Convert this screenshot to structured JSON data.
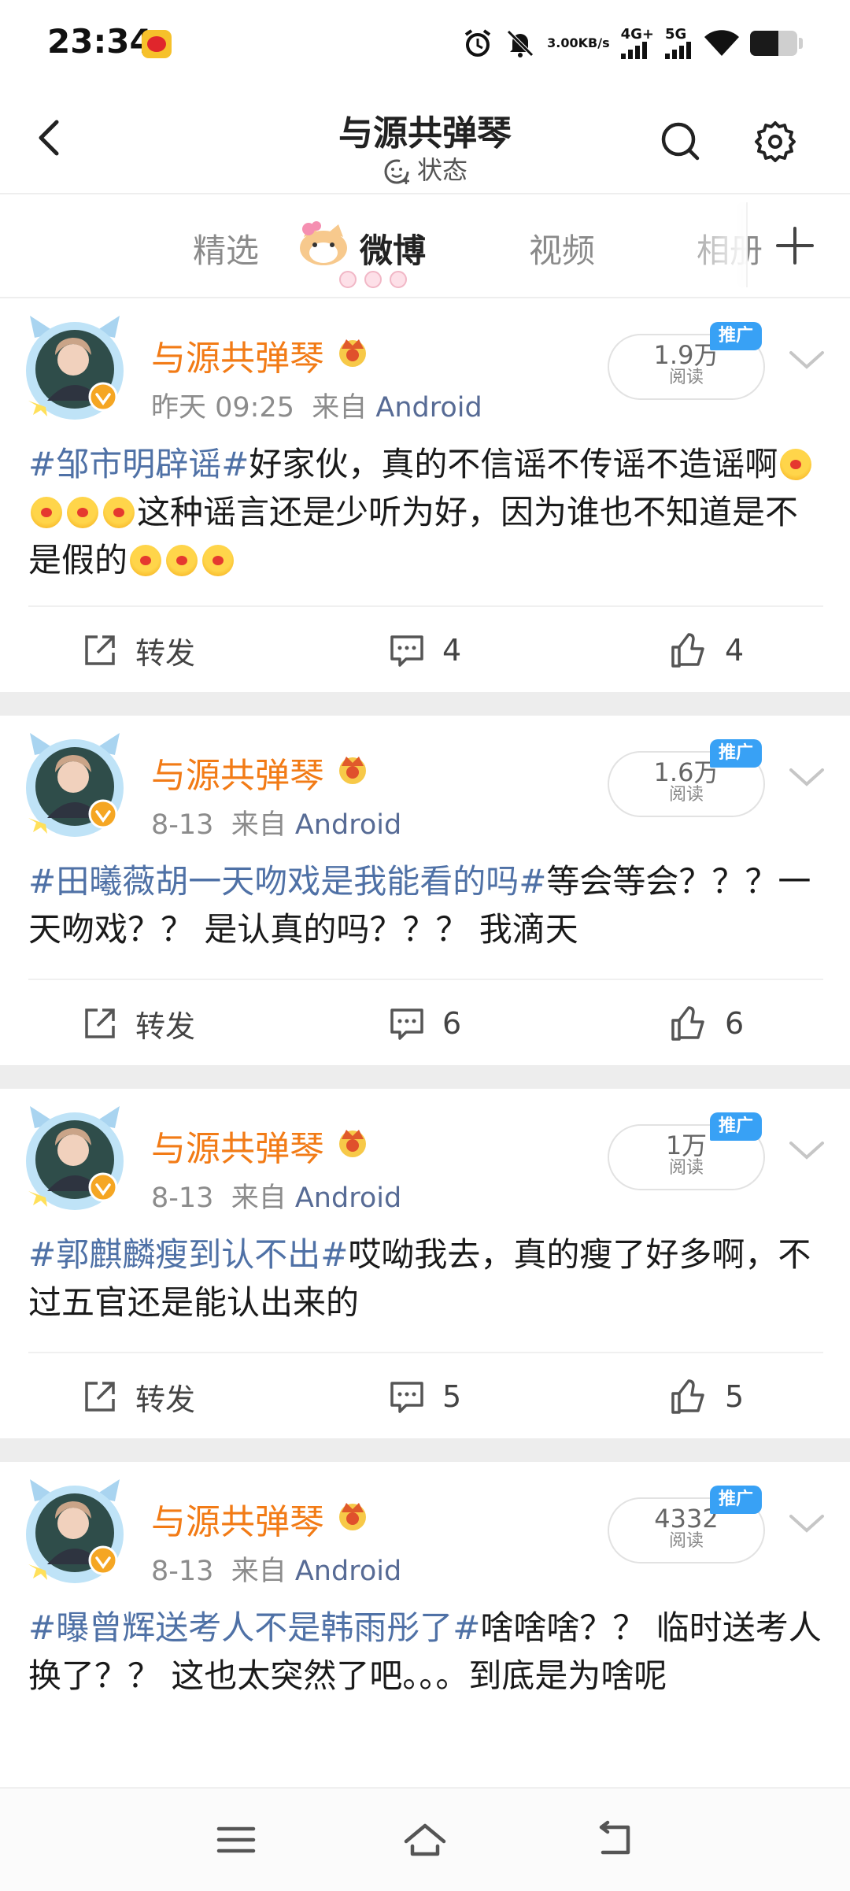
{
  "status_bar": {
    "time": "23:34",
    "net_speed_value": "3.00",
    "net_speed_unit": "KB/s",
    "signal_1": "4G+",
    "signal_2": "5G",
    "battery_level": 0.6,
    "icons": [
      "weibo-app-icon",
      "alarm-icon",
      "mute-icon",
      "signal-icon",
      "wifi-icon",
      "battery-icon"
    ]
  },
  "header": {
    "title": "与源共弹琴",
    "subtitle": "状态"
  },
  "tabs": [
    {
      "label": "精选",
      "active": false
    },
    {
      "label": "微博",
      "active": true
    },
    {
      "label": "视频",
      "active": false
    },
    {
      "label": "相册",
      "active": false
    }
  ],
  "posts": [
    {
      "username": "与源共弹琴",
      "time": "昨天 09:25",
      "source_prefix": "来自",
      "source": "Android",
      "reads_value": "1.9万",
      "reads_label": "阅读",
      "ad_label": "推广",
      "topic": "#邹市明辟谣#",
      "text_1": "好家伙，真的不信谣不传谣不造谣啊",
      "text_2": "这种谣言还是少听为好，因为谁也不知道是不是假的",
      "forward_label": "转发",
      "comments": "4",
      "likes": "4"
    },
    {
      "username": "与源共弹琴",
      "time": "8-13",
      "source_prefix": "来自",
      "source": "Android",
      "reads_value": "1.6万",
      "reads_label": "阅读",
      "ad_label": "推广",
      "topic": "#田曦薇胡一天吻戏是我能看的吗#",
      "text_1": "等会等会？？？一天吻戏？？ 是认真的吗？？？ 我滴天",
      "forward_label": "转发",
      "comments": "6",
      "likes": "6"
    },
    {
      "username": "与源共弹琴",
      "time": "8-13",
      "source_prefix": "来自",
      "source": "Android",
      "reads_value": "1万",
      "reads_label": "阅读",
      "ad_label": "推广",
      "topic": "#郭麒麟瘦到认不出#",
      "text_1": "哎呦我去，真的瘦了好多啊，不过五官还是能认出来的",
      "forward_label": "转发",
      "comments": "5",
      "likes": "5"
    },
    {
      "username": "与源共弹琴",
      "time": "8-13",
      "source_prefix": "来自",
      "source": "Android",
      "reads_value": "4332",
      "reads_label": "阅读",
      "ad_label": "推广",
      "topic": "#曝曾辉送考人不是韩雨彤了#",
      "text_1": "啥啥啥？？ 临时送考人换了？？ 这也太突然了吧。。。到底是为啥呢"
    }
  ],
  "colors": {
    "username": "#f27b16",
    "topic": "#4f71a6",
    "source": "#576b95",
    "ad_badge": "#38a1f5"
  }
}
